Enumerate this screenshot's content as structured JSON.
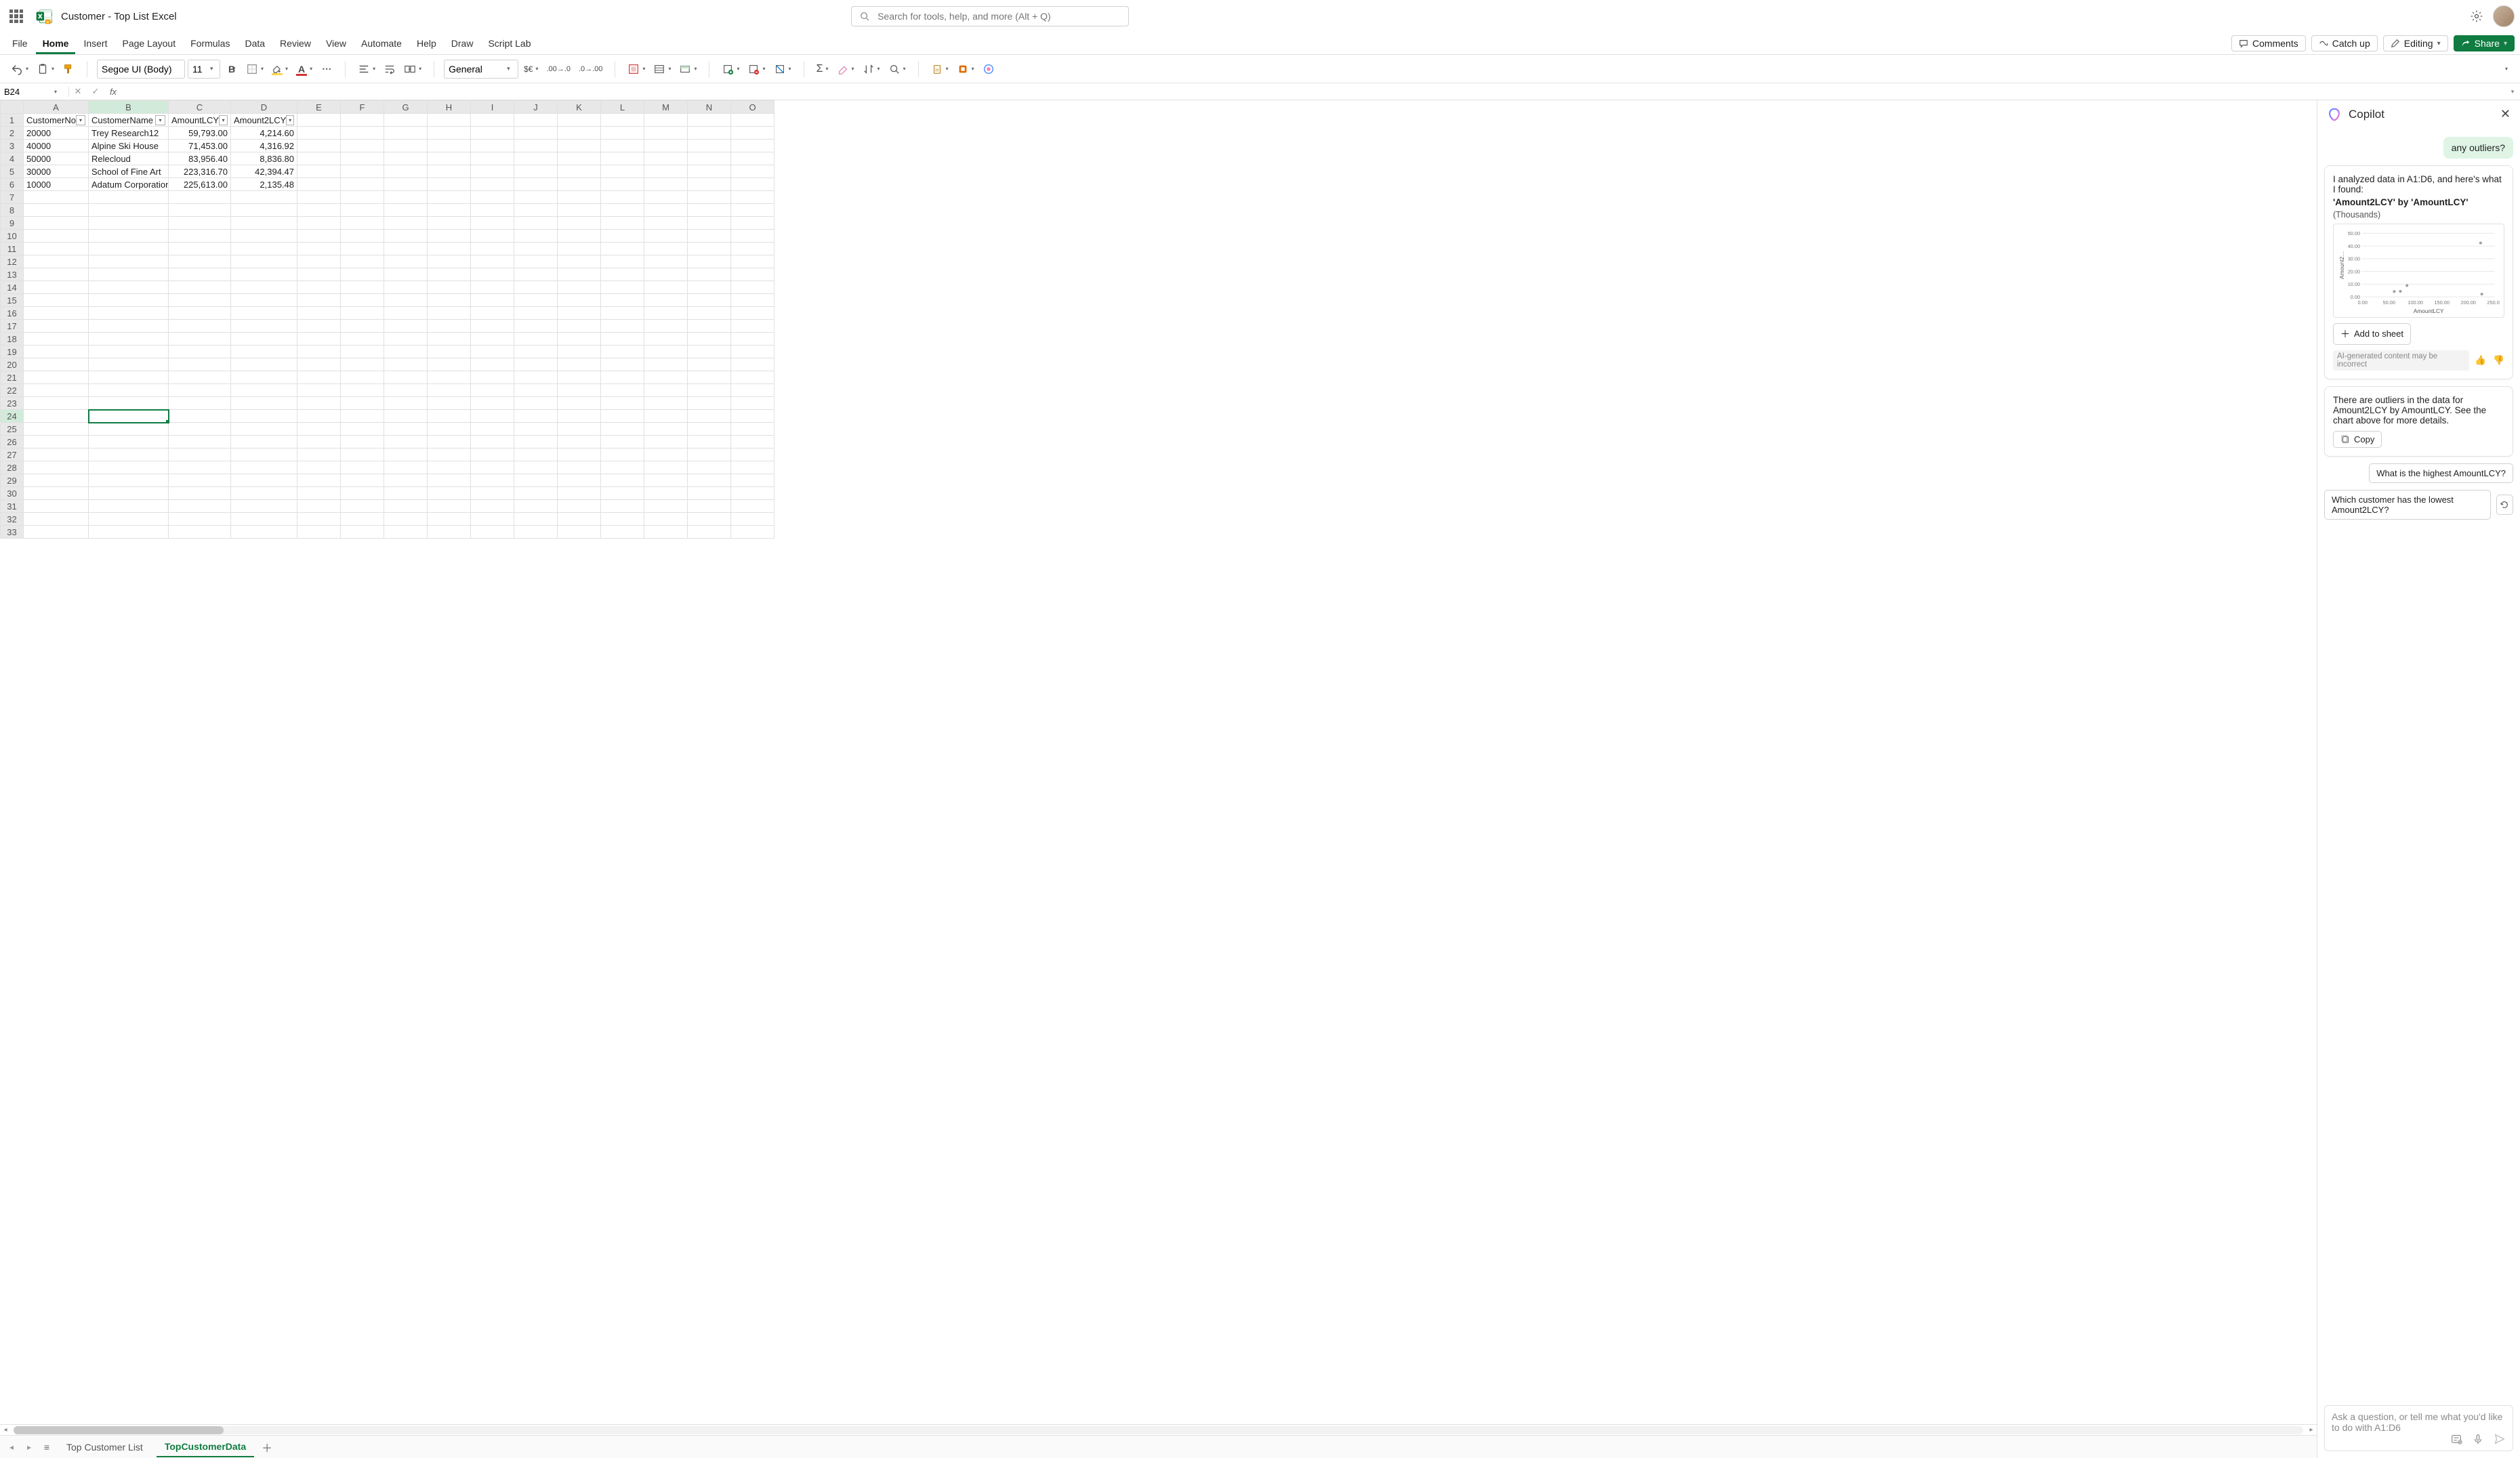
{
  "title_bar": {
    "doc_title": "Customer - Top List Excel",
    "search_placeholder": "Search for tools, help, and more (Alt + Q)"
  },
  "ribbon": {
    "tabs": [
      "File",
      "Home",
      "Insert",
      "Layout",
      "Formulas",
      "Data",
      "Review",
      "View",
      "Automate",
      "Help",
      "Draw",
      "ScriptLab"
    ],
    "tab_labels": {
      "File": "File",
      "Home": "Home",
      "Insert": "Insert",
      "Layout": "Page Layout",
      "Formulas": "Formulas",
      "Data": "Data",
      "Review": "Review",
      "View": "View",
      "Automate": "Automate",
      "Help": "Help",
      "Draw": "Draw",
      "ScriptLab": "Script Lab"
    },
    "active": "Home",
    "right": {
      "comments": "Comments",
      "catchup": "Catch up",
      "editing": "Editing",
      "share": "Share"
    }
  },
  "toolbar": {
    "font_name": "Segoe UI (Body)",
    "font_size": "11",
    "number_format": "General"
  },
  "formula_bar": {
    "cell_ref": "B24",
    "formula": ""
  },
  "columns": [
    "A",
    "B",
    "C",
    "D",
    "E",
    "F",
    "G",
    "H",
    "I",
    "J",
    "K",
    "L",
    "M",
    "N",
    "O"
  ],
  "col_widths": {
    "A": 96,
    "B": 118,
    "C": 92,
    "D": 98,
    "def": 64
  },
  "row_count": 33,
  "selected_cell": {
    "col": "B",
    "row": 24
  },
  "selected_col": "B",
  "headers": {
    "A": "CustomerNo",
    "B": "CustomerName",
    "C": "AmountLCY",
    "D": "Amount2LCY"
  },
  "data_rows": [
    {
      "A": "20000",
      "B": "Trey Research12",
      "C": "59,793.00",
      "D": "4,214.60"
    },
    {
      "A": "40000",
      "B": "Alpine Ski House",
      "C": "71,453.00",
      "D": "4,316.92"
    },
    {
      "A": "50000",
      "B": "Relecloud",
      "C": "83,956.40",
      "D": "8,836.80"
    },
    {
      "A": "30000",
      "B": "School of Fine Art",
      "C": "223,316.70",
      "D": "42,394.47"
    },
    {
      "A": "10000",
      "B": "Adatum Corporation",
      "C": "225,613.00",
      "D": "2,135.48"
    }
  ],
  "sheet_tabs": {
    "tabs": [
      "Top Customer List",
      "TopCustomerData"
    ],
    "active": "TopCustomerData"
  },
  "copilot": {
    "title": "Copilot",
    "user_prompt": "any outliers?",
    "analysis_intro": "I analyzed data in A1:D6, and here's what I found:",
    "chart_title": "'Amount2LCY' by 'AmountLCY'",
    "chart_sub": "(Thousands)",
    "add_to_sheet": "Add to sheet",
    "disclaimer": "AI-generated content may be incorrect",
    "explain": "There are outliers in the data for Amount2LCY by AmountLCY. See the chart above for more details.",
    "copy": "Copy",
    "suggest1": "What is the highest AmountLCY?",
    "suggest2": "Which customer has the lowest Amount2LCY?",
    "ask_placeholder": "Ask a question, or tell me what you'd like to do with A1:D6"
  },
  "chart_data": {
    "type": "scatter",
    "title": "'Amount2LCY' by 'AmountLCY'",
    "subtitle": "(Thousands)",
    "xlabel": "AmountLCY",
    "ylabel": "Amount2…",
    "x_ticks": [
      0,
      50,
      100,
      150,
      200,
      250
    ],
    "y_ticks": [
      0,
      10,
      20,
      30,
      40,
      50
    ],
    "xlim": [
      0,
      250
    ],
    "ylim": [
      0,
      50
    ],
    "points": [
      {
        "x": 59.79,
        "y": 4.21
      },
      {
        "x": 71.45,
        "y": 4.32
      },
      {
        "x": 83.96,
        "y": 8.84
      },
      {
        "x": 223.32,
        "y": 42.39
      },
      {
        "x": 225.61,
        "y": 2.14
      }
    ]
  }
}
